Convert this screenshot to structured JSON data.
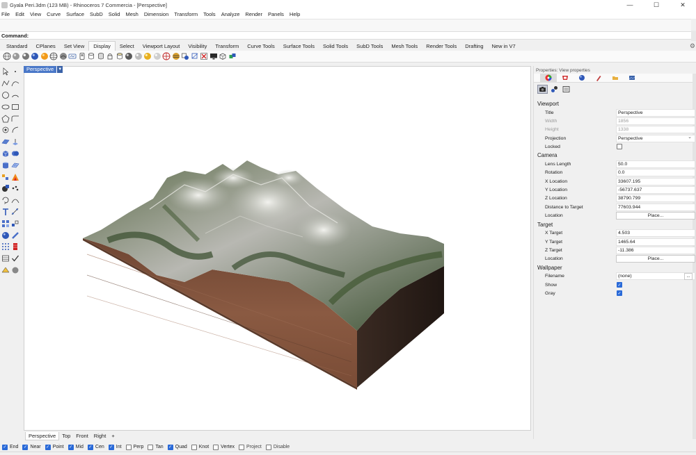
{
  "titlebar": {
    "title": "Gyala Peri.3dm (123 MB) - Rhinoceros 7 Commercia - [Perspective]",
    "minimize": "—",
    "maximize": "☐",
    "close": "✕"
  },
  "menu": [
    "File",
    "Edit",
    "View",
    "Curve",
    "Surface",
    "SubD",
    "Solid",
    "Mesh",
    "Dimension",
    "Transform",
    "Tools",
    "Analyze",
    "Render",
    "Panels",
    "Help"
  ],
  "command": {
    "label": "Command:",
    "value": ""
  },
  "tabs": [
    "Standard",
    "CPlanes",
    "Set View",
    "Display",
    "Select",
    "Viewport Layout",
    "Visibility",
    "Transform",
    "Curve Tools",
    "Surface Tools",
    "Solid Tools",
    "SubD Tools",
    "Mesh Tools",
    "Render Tools",
    "Drafting",
    "New in V7"
  ],
  "active_tab": "Display",
  "toolbar_icons": [
    "wireframe-icon",
    "shaded-icon",
    "rendered-icon",
    "ghosted-icon",
    "xray-icon",
    "technical-icon",
    "artistic-icon",
    "pen-icon",
    "raytraced-icon",
    "arctic-icon",
    "monochrome-icon",
    "lock-icon",
    "cage-icon",
    "gumball-icon",
    "sphere-icon",
    "sphere-icon",
    "sphere-icon",
    "sphere-icon",
    "zebra-icon",
    "environment-icon",
    "cutter-icon",
    "x-icon",
    "monitor-icon",
    "box-icon",
    "cubes-icon"
  ],
  "viewport": {
    "tab_label": "Perspective",
    "bottom_tabs": [
      "Perspective",
      "Top",
      "Front",
      "Right"
    ],
    "add_tab": "+"
  },
  "properties": {
    "header": "Properties: View properties",
    "sections": {
      "viewport": {
        "title": "Viewport",
        "rows": [
          {
            "label": "Title",
            "value": "Perspective"
          },
          {
            "label": "Width",
            "value": "1856"
          },
          {
            "label": "Height",
            "value": "1338"
          },
          {
            "label": "Projection",
            "value": "Perspective"
          },
          {
            "label": "Locked",
            "value": ""
          }
        ]
      },
      "camera": {
        "title": "Camera",
        "rows": [
          {
            "label": "Lens Length",
            "value": "50.0"
          },
          {
            "label": "Rotation",
            "value": "0.0"
          },
          {
            "label": "X Location",
            "value": "33607.195"
          },
          {
            "label": "Y Location",
            "value": "-56737.637"
          },
          {
            "label": "Z Location",
            "value": "38790.799"
          },
          {
            "label": "Distance to Target",
            "value": "77603.944"
          },
          {
            "label": "Location",
            "value": "Place..."
          }
        ]
      },
      "target": {
        "title": "Target",
        "rows": [
          {
            "label": "X Target",
            "value": "4.503"
          },
          {
            "label": "Y Target",
            "value": "1465.64"
          },
          {
            "label": "Z Target",
            "value": "-11.386"
          },
          {
            "label": "Location",
            "value": "Place..."
          }
        ]
      },
      "wallpaper": {
        "title": "Wallpaper",
        "rows": [
          {
            "label": "Filename",
            "value": "(none)"
          },
          {
            "label": "Show",
            "value": ""
          },
          {
            "label": "Gray",
            "value": ""
          }
        ],
        "browse": "..."
      }
    }
  },
  "osnaps": [
    {
      "label": "End",
      "checked": true
    },
    {
      "label": "Near",
      "checked": true
    },
    {
      "label": "Point",
      "checked": true
    },
    {
      "label": "Mid",
      "checked": true
    },
    {
      "label": "Cen",
      "checked": true
    },
    {
      "label": "Int",
      "checked": true
    },
    {
      "label": "Perp",
      "checked": false
    },
    {
      "label": "Tan",
      "checked": false
    },
    {
      "label": "Quad",
      "checked": true
    },
    {
      "label": "Knot",
      "checked": false
    },
    {
      "label": "Vertex",
      "checked": false
    },
    {
      "label": "Project",
      "checked": false
    },
    {
      "label": "Disable",
      "checked": false
    }
  ],
  "colors": {
    "accent": "#2a6ad8",
    "viewport_tab": "#4a78c8",
    "terrain_soil": "#7a4e38",
    "terrain_dark": "#3b2a22",
    "terrain_green": "#4b5e3a",
    "terrain_snow": "#d8d8d4"
  }
}
